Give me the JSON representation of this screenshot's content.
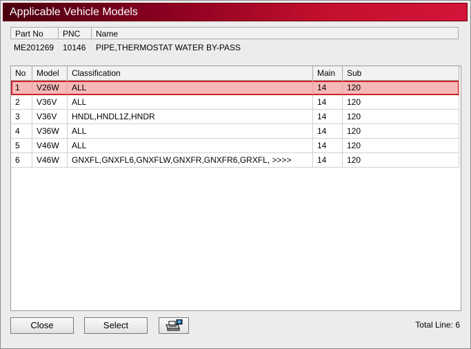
{
  "window": {
    "title": "Applicable Vehicle Models"
  },
  "part": {
    "headers": {
      "part_no": "Part No",
      "pnc": "PNC",
      "name": "Name"
    },
    "values": {
      "part_no": "ME201269",
      "pnc": "10146",
      "name": "PIPE,THERMOSTAT WATER BY-PASS"
    }
  },
  "table": {
    "headers": {
      "no": "No",
      "model": "Model",
      "classification": "Classification",
      "main": "Main",
      "sub": "Sub"
    },
    "rows": [
      {
        "no": "1",
        "model": "V26W",
        "classification": "ALL",
        "main": "14",
        "sub": "120",
        "selected": true
      },
      {
        "no": "2",
        "model": "V36V",
        "classification": "ALL",
        "main": "14",
        "sub": "120"
      },
      {
        "no": "3",
        "model": "V36V",
        "classification": "HNDL,HNDL1Z,HNDR",
        "main": "14",
        "sub": "120"
      },
      {
        "no": "4",
        "model": "V36W",
        "classification": "ALL",
        "main": "14",
        "sub": "120"
      },
      {
        "no": "5",
        "model": "V46W",
        "classification": "ALL",
        "main": "14",
        "sub": "120"
      },
      {
        "no": "6",
        "model": "V46W",
        "classification": "GNXFL,GNXFL6,GNXFLW,GNXFR,GNXFR6,GRXFL,  >>>>",
        "main": "14",
        "sub": "120"
      }
    ]
  },
  "buttons": {
    "close": "Close",
    "select": "Select",
    "print_icon": "printer-icon"
  },
  "footer": {
    "total_line": "Total Line: 6"
  },
  "colors": {
    "title_start": "#4a0010",
    "title_end": "#d4143a",
    "selection_bg": "#f7b8b8",
    "selection_border": "#c8242a"
  }
}
